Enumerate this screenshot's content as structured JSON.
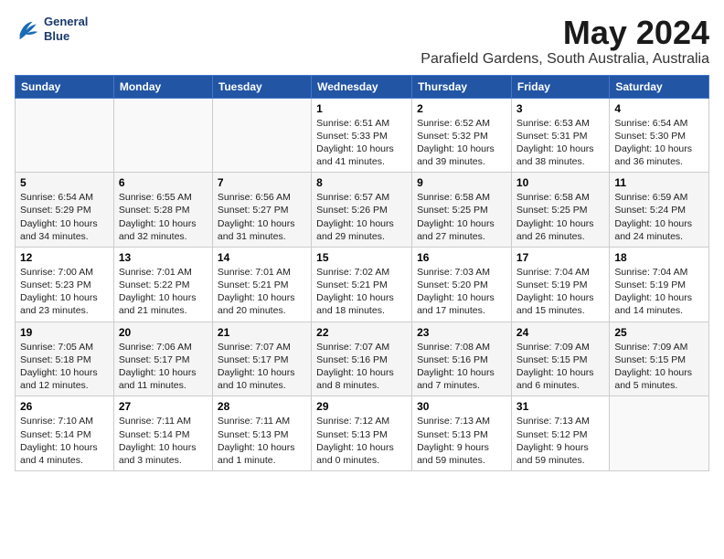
{
  "header": {
    "logo_line1": "General",
    "logo_line2": "Blue",
    "month": "May 2024",
    "location": "Parafield Gardens, South Australia, Australia"
  },
  "days_of_week": [
    "Sunday",
    "Monday",
    "Tuesday",
    "Wednesday",
    "Thursday",
    "Friday",
    "Saturday"
  ],
  "weeks": [
    [
      {
        "day": "",
        "info": ""
      },
      {
        "day": "",
        "info": ""
      },
      {
        "day": "",
        "info": ""
      },
      {
        "day": "1",
        "info": "Sunrise: 6:51 AM\nSunset: 5:33 PM\nDaylight: 10 hours\nand 41 minutes."
      },
      {
        "day": "2",
        "info": "Sunrise: 6:52 AM\nSunset: 5:32 PM\nDaylight: 10 hours\nand 39 minutes."
      },
      {
        "day": "3",
        "info": "Sunrise: 6:53 AM\nSunset: 5:31 PM\nDaylight: 10 hours\nand 38 minutes."
      },
      {
        "day": "4",
        "info": "Sunrise: 6:54 AM\nSunset: 5:30 PM\nDaylight: 10 hours\nand 36 minutes."
      }
    ],
    [
      {
        "day": "5",
        "info": "Sunrise: 6:54 AM\nSunset: 5:29 PM\nDaylight: 10 hours\nand 34 minutes."
      },
      {
        "day": "6",
        "info": "Sunrise: 6:55 AM\nSunset: 5:28 PM\nDaylight: 10 hours\nand 32 minutes."
      },
      {
        "day": "7",
        "info": "Sunrise: 6:56 AM\nSunset: 5:27 PM\nDaylight: 10 hours\nand 31 minutes."
      },
      {
        "day": "8",
        "info": "Sunrise: 6:57 AM\nSunset: 5:26 PM\nDaylight: 10 hours\nand 29 minutes."
      },
      {
        "day": "9",
        "info": "Sunrise: 6:58 AM\nSunset: 5:25 PM\nDaylight: 10 hours\nand 27 minutes."
      },
      {
        "day": "10",
        "info": "Sunrise: 6:58 AM\nSunset: 5:25 PM\nDaylight: 10 hours\nand 26 minutes."
      },
      {
        "day": "11",
        "info": "Sunrise: 6:59 AM\nSunset: 5:24 PM\nDaylight: 10 hours\nand 24 minutes."
      }
    ],
    [
      {
        "day": "12",
        "info": "Sunrise: 7:00 AM\nSunset: 5:23 PM\nDaylight: 10 hours\nand 23 minutes."
      },
      {
        "day": "13",
        "info": "Sunrise: 7:01 AM\nSunset: 5:22 PM\nDaylight: 10 hours\nand 21 minutes."
      },
      {
        "day": "14",
        "info": "Sunrise: 7:01 AM\nSunset: 5:21 PM\nDaylight: 10 hours\nand 20 minutes."
      },
      {
        "day": "15",
        "info": "Sunrise: 7:02 AM\nSunset: 5:21 PM\nDaylight: 10 hours\nand 18 minutes."
      },
      {
        "day": "16",
        "info": "Sunrise: 7:03 AM\nSunset: 5:20 PM\nDaylight: 10 hours\nand 17 minutes."
      },
      {
        "day": "17",
        "info": "Sunrise: 7:04 AM\nSunset: 5:19 PM\nDaylight: 10 hours\nand 15 minutes."
      },
      {
        "day": "18",
        "info": "Sunrise: 7:04 AM\nSunset: 5:19 PM\nDaylight: 10 hours\nand 14 minutes."
      }
    ],
    [
      {
        "day": "19",
        "info": "Sunrise: 7:05 AM\nSunset: 5:18 PM\nDaylight: 10 hours\nand 12 minutes."
      },
      {
        "day": "20",
        "info": "Sunrise: 7:06 AM\nSunset: 5:17 PM\nDaylight: 10 hours\nand 11 minutes."
      },
      {
        "day": "21",
        "info": "Sunrise: 7:07 AM\nSunset: 5:17 PM\nDaylight: 10 hours\nand 10 minutes."
      },
      {
        "day": "22",
        "info": "Sunrise: 7:07 AM\nSunset: 5:16 PM\nDaylight: 10 hours\nand 8 minutes."
      },
      {
        "day": "23",
        "info": "Sunrise: 7:08 AM\nSunset: 5:16 PM\nDaylight: 10 hours\nand 7 minutes."
      },
      {
        "day": "24",
        "info": "Sunrise: 7:09 AM\nSunset: 5:15 PM\nDaylight: 10 hours\nand 6 minutes."
      },
      {
        "day": "25",
        "info": "Sunrise: 7:09 AM\nSunset: 5:15 PM\nDaylight: 10 hours\nand 5 minutes."
      }
    ],
    [
      {
        "day": "26",
        "info": "Sunrise: 7:10 AM\nSunset: 5:14 PM\nDaylight: 10 hours\nand 4 minutes."
      },
      {
        "day": "27",
        "info": "Sunrise: 7:11 AM\nSunset: 5:14 PM\nDaylight: 10 hours\nand 3 minutes."
      },
      {
        "day": "28",
        "info": "Sunrise: 7:11 AM\nSunset: 5:13 PM\nDaylight: 10 hours\nand 1 minute."
      },
      {
        "day": "29",
        "info": "Sunrise: 7:12 AM\nSunset: 5:13 PM\nDaylight: 10 hours\nand 0 minutes."
      },
      {
        "day": "30",
        "info": "Sunrise: 7:13 AM\nSunset: 5:13 PM\nDaylight: 9 hours\nand 59 minutes."
      },
      {
        "day": "31",
        "info": "Sunrise: 7:13 AM\nSunset: 5:12 PM\nDaylight: 9 hours\nand 59 minutes."
      },
      {
        "day": "",
        "info": ""
      }
    ]
  ]
}
